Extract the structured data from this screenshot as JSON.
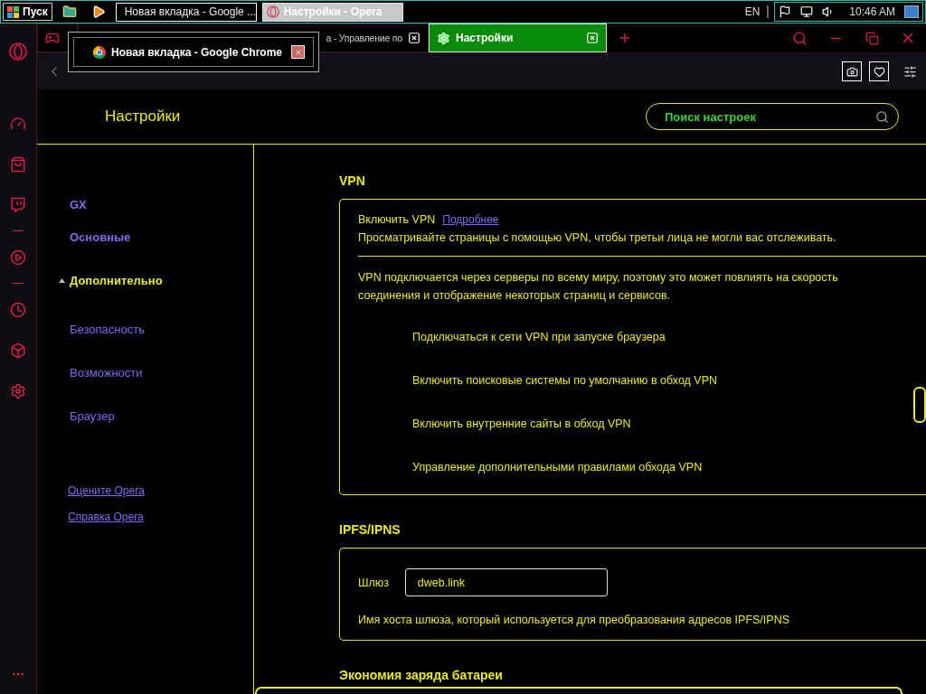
{
  "taskbar": {
    "start_label": "Пуск",
    "quick_launch": [
      {
        "kind": "folder"
      },
      {
        "kind": "player"
      }
    ],
    "windows": [
      {
        "kind": "chrome",
        "title": "Новая вкладка - Google ...",
        "selected": false,
        "hovered": true
      },
      {
        "kind": "opera",
        "title": "Настройки - Opera",
        "selected": true,
        "hovered": false
      }
    ],
    "language": "EN",
    "clock": "10:46 AM"
  },
  "tooltip": {
    "kind": "chrome",
    "title": "Новая вкладка - Google Chrome"
  },
  "tabs": [
    {
      "kind": "gx",
      "selected": false
    },
    {
      "kind": "page",
      "label": "а - Управление по",
      "selected": false
    },
    {
      "kind": "settings",
      "label": "Настройки",
      "selected": true
    }
  ],
  "page": {
    "title": "Настройки",
    "search": {
      "placeholder": "Поиск настроек"
    }
  },
  "nav": {
    "items": [
      {
        "label": "GX",
        "kind": "top",
        "selected": false,
        "expanded": false
      },
      {
        "label": "Основные",
        "kind": "top",
        "selected": false,
        "expanded": false
      },
      {
        "label": "Дополнительно",
        "kind": "top",
        "selected": true,
        "expanded": true
      },
      {
        "label": "Безопасность",
        "kind": "sub",
        "selected": false,
        "expanded": false
      },
      {
        "label": "Возможности",
        "kind": "sub",
        "selected": false,
        "expanded": false
      },
      {
        "label": "Браузер",
        "kind": "sub",
        "selected": false,
        "expanded": false
      }
    ],
    "links": [
      "Оцените Opera",
      "Справка Opera"
    ]
  },
  "sections": [
    {
      "kind": "vpn",
      "title": "VPN",
      "toggle_label": "Включить VPN",
      "link": "Подробнее",
      "description": "Просматривайте страницы с помощью VPN, чтобы третьи лица не могли вас отслеживать.",
      "note": "VPN подключается через серверы по всему миру, поэтому это может повлиять на скорость соединения и отображение некоторых страниц и сервисов.",
      "options": [
        "Подключаться к сети VPN при запуске браузера",
        "Включить поисковые системы по умолчанию в обход VPN",
        "Включить внутренние сайты в обход VPN",
        "Управление дополнительными правилами обхода VPN"
      ]
    },
    {
      "kind": "ipfs",
      "title": "IPFS/IPNS",
      "field_label": "Шлюз",
      "field_value": "dweb.link",
      "description": "Имя хоста шлюза, который используется для преобразования адресов IPFS/IPNS"
    },
    {
      "kind": "heading",
      "title": "Экономия заряда батареи"
    }
  ]
}
